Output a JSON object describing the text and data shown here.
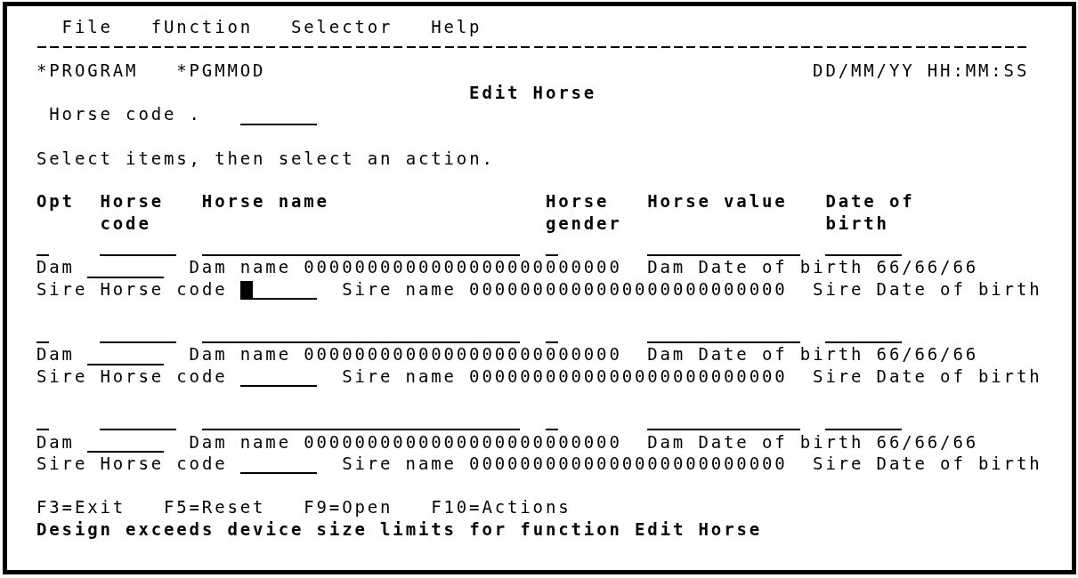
{
  "menu_bar": [
    {
      "label": "File"
    },
    {
      "label": "fUnction"
    },
    {
      "label": "Selector"
    },
    {
      "label": "Help"
    }
  ],
  "header": {
    "program": "*PROGRAM",
    "module": "*PGMMOD",
    "datetime": "DD/MM/YY HH:MM:SS",
    "title": "Edit Horse"
  },
  "key_field": {
    "label": "Horse code ."
  },
  "instruction": "Select items, then select an action.",
  "columns": [
    {
      "lines": [
        "Opt"
      ]
    },
    {
      "lines": [
        "Horse",
        "code"
      ]
    },
    {
      "lines": [
        "Horse name"
      ]
    },
    {
      "lines": [
        "Horse",
        "gender"
      ]
    },
    {
      "lines": [
        "Horse value"
      ]
    },
    {
      "lines": [
        "Date of",
        "birth"
      ]
    }
  ],
  "records": [
    {
      "dam": {
        "label": "Dam",
        "name_label": "Dam name",
        "name": "0000000000000000000000000",
        "dob_label": "Dam Date of birth",
        "dob": "66/66/66"
      },
      "sire": {
        "code_label": "Sire Horse code",
        "cursor": true,
        "name_label": "Sire name",
        "name": "0000000000000000000000000",
        "dob_label": "Sire Date of birth"
      }
    },
    {
      "dam": {
        "label": "Dam",
        "name_label": "Dam name",
        "name": "0000000000000000000000000",
        "dob_label": "Dam Date of birth",
        "dob": "66/66/66"
      },
      "sire": {
        "code_label": "Sire Horse code",
        "cursor": false,
        "name_label": "Sire name",
        "name": "0000000000000000000000000",
        "dob_label": "Sire Date of birth"
      }
    },
    {
      "dam": {
        "label": "Dam",
        "name_label": "Dam name",
        "name": "0000000000000000000000000",
        "dob_label": "Dam Date of birth",
        "dob": "66/66/66"
      },
      "sire": {
        "code_label": "Sire Horse code",
        "cursor": false,
        "name_label": "Sire name",
        "name": "0000000000000000000000000",
        "dob_label": "Sire Date of birth"
      }
    }
  ],
  "function_keys": [
    "F3=Exit",
    "F5=Reset",
    "F9=Open",
    "F10=Actions"
  ],
  "message": "Design exceeds device size limits for function Edit Horse"
}
